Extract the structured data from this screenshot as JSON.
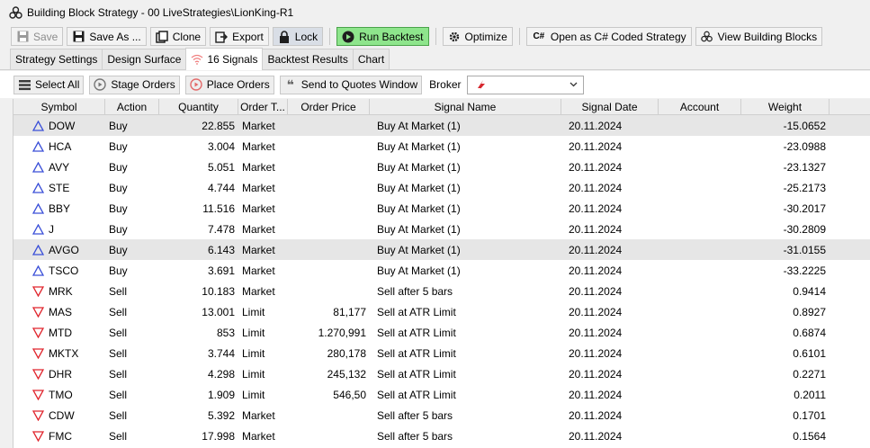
{
  "window": {
    "title": "Building Block Strategy - 00 LiveStrategies\\LionKing-R1"
  },
  "toolbar": {
    "save": "Save",
    "save_as": "Save As ...",
    "clone": "Clone",
    "export": "Export",
    "lock": "Lock",
    "run_backtest": "Run Backtest",
    "optimize": "Optimize",
    "open_csharp": "Open as C# Coded Strategy",
    "view_blocks": "View Building Blocks",
    "csharp_glyph": "C#"
  },
  "tabs": [
    {
      "label": "Strategy Settings"
    },
    {
      "label": "Design Surface"
    },
    {
      "label": "16 Signals"
    },
    {
      "label": "Backtest Results"
    },
    {
      "label": "Chart"
    }
  ],
  "actions": {
    "select_all": "Select All",
    "stage_orders": "Stage Orders",
    "place_orders": "Place Orders",
    "send_quotes": "Send to Quotes Window",
    "broker_label": "Broker",
    "broker_icon": "broker-logo-icon"
  },
  "grid": {
    "columns": [
      "Symbol",
      "Action",
      "Quantity",
      "Order T...",
      "Order Price",
      "Signal Name",
      "Signal Date",
      "Account",
      "Weight"
    ],
    "rows": [
      {
        "symbol": "DOW",
        "action": "Buy",
        "quantity": "22.855",
        "order_type": "Market",
        "order_price": "",
        "signal_name": "Buy At Market (1)",
        "signal_date": "20.11.2024",
        "account": "",
        "weight": "-15.0652"
      },
      {
        "symbol": "HCA",
        "action": "Buy",
        "quantity": "3.004",
        "order_type": "Market",
        "order_price": "",
        "signal_name": "Buy At Market (1)",
        "signal_date": "20.11.2024",
        "account": "",
        "weight": "-23.0988"
      },
      {
        "symbol": "AVY",
        "action": "Buy",
        "quantity": "5.051",
        "order_type": "Market",
        "order_price": "",
        "signal_name": "Buy At Market (1)",
        "signal_date": "20.11.2024",
        "account": "",
        "weight": "-23.1327"
      },
      {
        "symbol": "STE",
        "action": "Buy",
        "quantity": "4.744",
        "order_type": "Market",
        "order_price": "",
        "signal_name": "Buy At Market (1)",
        "signal_date": "20.11.2024",
        "account": "",
        "weight": "-25.2173"
      },
      {
        "symbol": "BBY",
        "action": "Buy",
        "quantity": "11.516",
        "order_type": "Market",
        "order_price": "",
        "signal_name": "Buy At Market (1)",
        "signal_date": "20.11.2024",
        "account": "",
        "weight": "-30.2017"
      },
      {
        "symbol": "J",
        "action": "Buy",
        "quantity": "7.478",
        "order_type": "Market",
        "order_price": "",
        "signal_name": "Buy At Market (1)",
        "signal_date": "20.11.2024",
        "account": "",
        "weight": "-30.2809"
      },
      {
        "symbol": "AVGO",
        "action": "Buy",
        "quantity": "6.143",
        "order_type": "Market",
        "order_price": "",
        "signal_name": "Buy At Market (1)",
        "signal_date": "20.11.2024",
        "account": "",
        "weight": "-31.0155"
      },
      {
        "symbol": "TSCO",
        "action": "Buy",
        "quantity": "3.691",
        "order_type": "Market",
        "order_price": "",
        "signal_name": "Buy At Market (1)",
        "signal_date": "20.11.2024",
        "account": "",
        "weight": "-33.2225"
      },
      {
        "symbol": "MRK",
        "action": "Sell",
        "quantity": "10.183",
        "order_type": "Market",
        "order_price": "",
        "signal_name": "Sell after 5 bars",
        "signal_date": "20.11.2024",
        "account": "",
        "weight": "0.9414"
      },
      {
        "symbol": "MAS",
        "action": "Sell",
        "quantity": "13.001",
        "order_type": "Limit",
        "order_price": "81,177",
        "signal_name": "Sell at ATR Limit",
        "signal_date": "20.11.2024",
        "account": "",
        "weight": "0.8927"
      },
      {
        "symbol": "MTD",
        "action": "Sell",
        "quantity": "853",
        "order_type": "Limit",
        "order_price": "1.270,991",
        "signal_name": "Sell at ATR Limit",
        "signal_date": "20.11.2024",
        "account": "",
        "weight": "0.6874"
      },
      {
        "symbol": "MKTX",
        "action": "Sell",
        "quantity": "3.744",
        "order_type": "Limit",
        "order_price": "280,178",
        "signal_name": "Sell at ATR Limit",
        "signal_date": "20.11.2024",
        "account": "",
        "weight": "0.6101"
      },
      {
        "symbol": "DHR",
        "action": "Sell",
        "quantity": "4.298",
        "order_type": "Limit",
        "order_price": "245,132",
        "signal_name": "Sell at ATR Limit",
        "signal_date": "20.11.2024",
        "account": "",
        "weight": "0.2271"
      },
      {
        "symbol": "TMO",
        "action": "Sell",
        "quantity": "1.909",
        "order_type": "Limit",
        "order_price": "546,50",
        "signal_name": "Sell at ATR Limit",
        "signal_date": "20.11.2024",
        "account": "",
        "weight": "0.2011"
      },
      {
        "symbol": "CDW",
        "action": "Sell",
        "quantity": "5.392",
        "order_type": "Market",
        "order_price": "",
        "signal_name": "Sell after 5 bars",
        "signal_date": "20.11.2024",
        "account": "",
        "weight": "0.1701"
      },
      {
        "symbol": "FMC",
        "action": "Sell",
        "quantity": "17.998",
        "order_type": "Market",
        "order_price": "",
        "signal_name": "Sell after 5 bars",
        "signal_date": "20.11.2024",
        "account": "",
        "weight": "0.1564"
      }
    ]
  },
  "colors": {
    "buy_icon": "#3a4fd8",
    "sell_icon": "#e0242c",
    "run_backtest_bg": "#8ee58c",
    "selected_row": "#e6e6e6"
  }
}
